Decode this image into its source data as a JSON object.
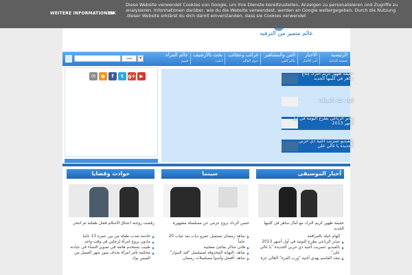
{
  "cookie": {
    "message": "Diese Website verwendet Cookies von Google, um ihre Dienste bereitzustellen, Anzeigen zu personalisieren und Zugriffe zu analysieren. Informationen darüber, wie du die Website verwendest, werden an Google weitergegeben. Durch die Nutzung dieser Website erklärst du dich damit einverstanden, dass sie Cookies verwendet.",
    "more_label": "WEITERE INFORMATIONEN",
    "ok_label": "OK"
  },
  "header": {
    "tagline": "عالم متميز من الترفيه"
  },
  "nav": {
    "items": [
      {
        "label": "الرئيسية",
        "sub": "صفحة البداية"
      },
      {
        "label": "الأخبار",
        "sub": "آخر الأخبار"
      },
      {
        "label": "الفن والمشاهير",
        "sub": "عالم الفن"
      },
      {
        "label": "غرائب وعجائب",
        "sub": "حول العالم"
      },
      {
        "label": "بحث بالأرشيف",
        "sub": "ابحث"
      },
      {
        "label": "عالم المرأة",
        "sub": "قسم"
      }
    ],
    "search_button": "بحث",
    "search_placeholder": ""
  },
  "colors": {
    "accent": "#2e7fd1",
    "dark_blue": "#1666b8",
    "strip": "#2b6fb8"
  },
  "social": [
    {
      "icon": "youtube-icon",
      "glyph": "▶",
      "color": "#d8362a"
    },
    {
      "icon": "google-plus-icon",
      "glyph": "g+",
      "color": "#d34836"
    },
    {
      "icon": "twitter-icon",
      "glyph": "t",
      "color": "#2aa9e0"
    },
    {
      "icon": "facebook-icon",
      "glyph": "f",
      "color": "#3b5998"
    },
    {
      "icon": "rss-icon",
      "glyph": "◉",
      "color": "#f29423"
    },
    {
      "icon": "mail-icon",
      "glyph": "✉",
      "color": "#8c8c8c"
    }
  ],
  "slider": {
    "items": [
      {
        "text": "حقيقة ظهور كريم الترك إنتاج ساهر في كليبها الجديد",
        "light": false
      },
      {
        "text": "إلهام خيلة بالمرافعة",
        "light": true
      },
      {
        "text": "صابر الرباعي يطرح البومة في أول أشهر 2013",
        "light": false
      },
      {
        "text": "بالفيديو تسريب أغنية دي حزبي الجديدة يا غالي علي",
        "light": false
      }
    ]
  },
  "columns": [
    {
      "title": "أخبار الموسيقى",
      "caption": "حقيقة ظهور كريم الترك مع أمال ساهر في كليبها الجديد",
      "list": [
        {
          "text": "إلهام خيلة بالمرافعة",
          "bullet": false
        },
        {
          "text": "صابر الرباعي يطرح البومة في أول أشهر 2013",
          "bullet": true
        },
        {
          "text": "بالفيديو :تسريب أغنية دي حزبي الجديدة \"يا غالي علي\"",
          "bullet": true
        },
        {
          "text": "مجد القاسم يهدي أغنية \"ورب العزة\" لأهالي غزة",
          "bullet": true
        }
      ]
    },
    {
      "title": "سينما",
      "caption": "حسن الرداد نزوع عزمي عن مسلسلة مشهورة",
      "list": [
        {
          "text": "شاهد رمضان تستقبل عمرو دياب بعد غياب 20 عاماً",
          "bullet": true
        },
        {
          "text": "هاني شاكر يفاجئ معجبيه",
          "bullet": true
        },
        {
          "text": "شاهد :النهاية المحذوفة لمسلسل \"قيد النيول\"",
          "bullet": true
        },
        {
          "text": "شاهد :أفضل وأسوأ مسلسلات رمضان",
          "bullet": true
        }
      ]
    },
    {
      "title": "حوادث وقضايا",
      "caption": "رفضت زوجته اعتناق الاسلام فقتل طفلته ثم انتحر",
      "list": [
        {
          "text": "خادمة تعذب طفلة من بين عمره 13 عاما",
          "bullet": true
        },
        {
          "text": "ماذون يزوج امرأة لرجلين في وقت واحد",
          "bullet": true
        },
        {
          "text": "طبيب يستخدم هاتفه في تصوير النساء في عيادته",
          "bullet": true
        },
        {
          "text": "محكمة تأمر امرأة بحذف صور شهر العسل من الفيس بوك",
          "bullet": true
        }
      ]
    }
  ]
}
